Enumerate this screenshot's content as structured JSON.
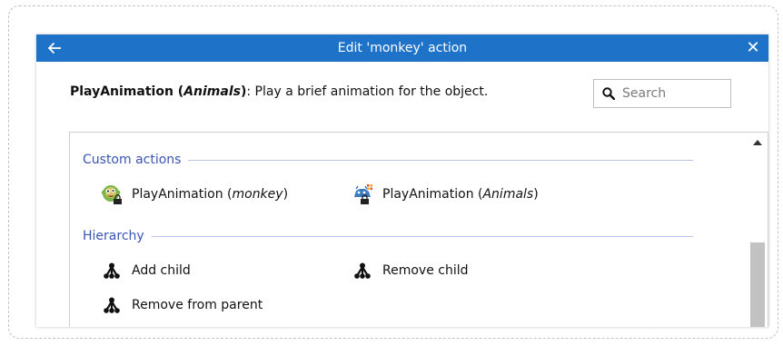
{
  "dialog": {
    "title": "Edit 'monkey' action",
    "back_icon": "arrow-left-icon",
    "close_label": "✕"
  },
  "description": {
    "name": "PlayAnimation (",
    "name_italic": "Animals",
    "name_end": ")",
    "text": ": Play a brief animation for the object."
  },
  "search": {
    "placeholder": "Search",
    "value": ""
  },
  "sections": [
    {
      "title": "Custom actions",
      "items": [
        {
          "label": "PlayAnimation (",
          "label_italic": "monkey",
          "label_end": ")",
          "icon": "monkey-object-icon"
        },
        {
          "label": "PlayAnimation (",
          "label_italic": "Animals",
          "label_end": ")",
          "icon": "animals-group-icon"
        }
      ]
    },
    {
      "title": "Hierarchy",
      "items": [
        {
          "label": "Add child",
          "icon": "hierarchy-icon"
        },
        {
          "label": "Remove child",
          "icon": "hierarchy-icon"
        },
        {
          "label": "Remove from parent",
          "icon": "hierarchy-icon"
        }
      ]
    }
  ],
  "colors": {
    "titlebar": "#1e73c9",
    "section_header": "#3a55b4"
  }
}
